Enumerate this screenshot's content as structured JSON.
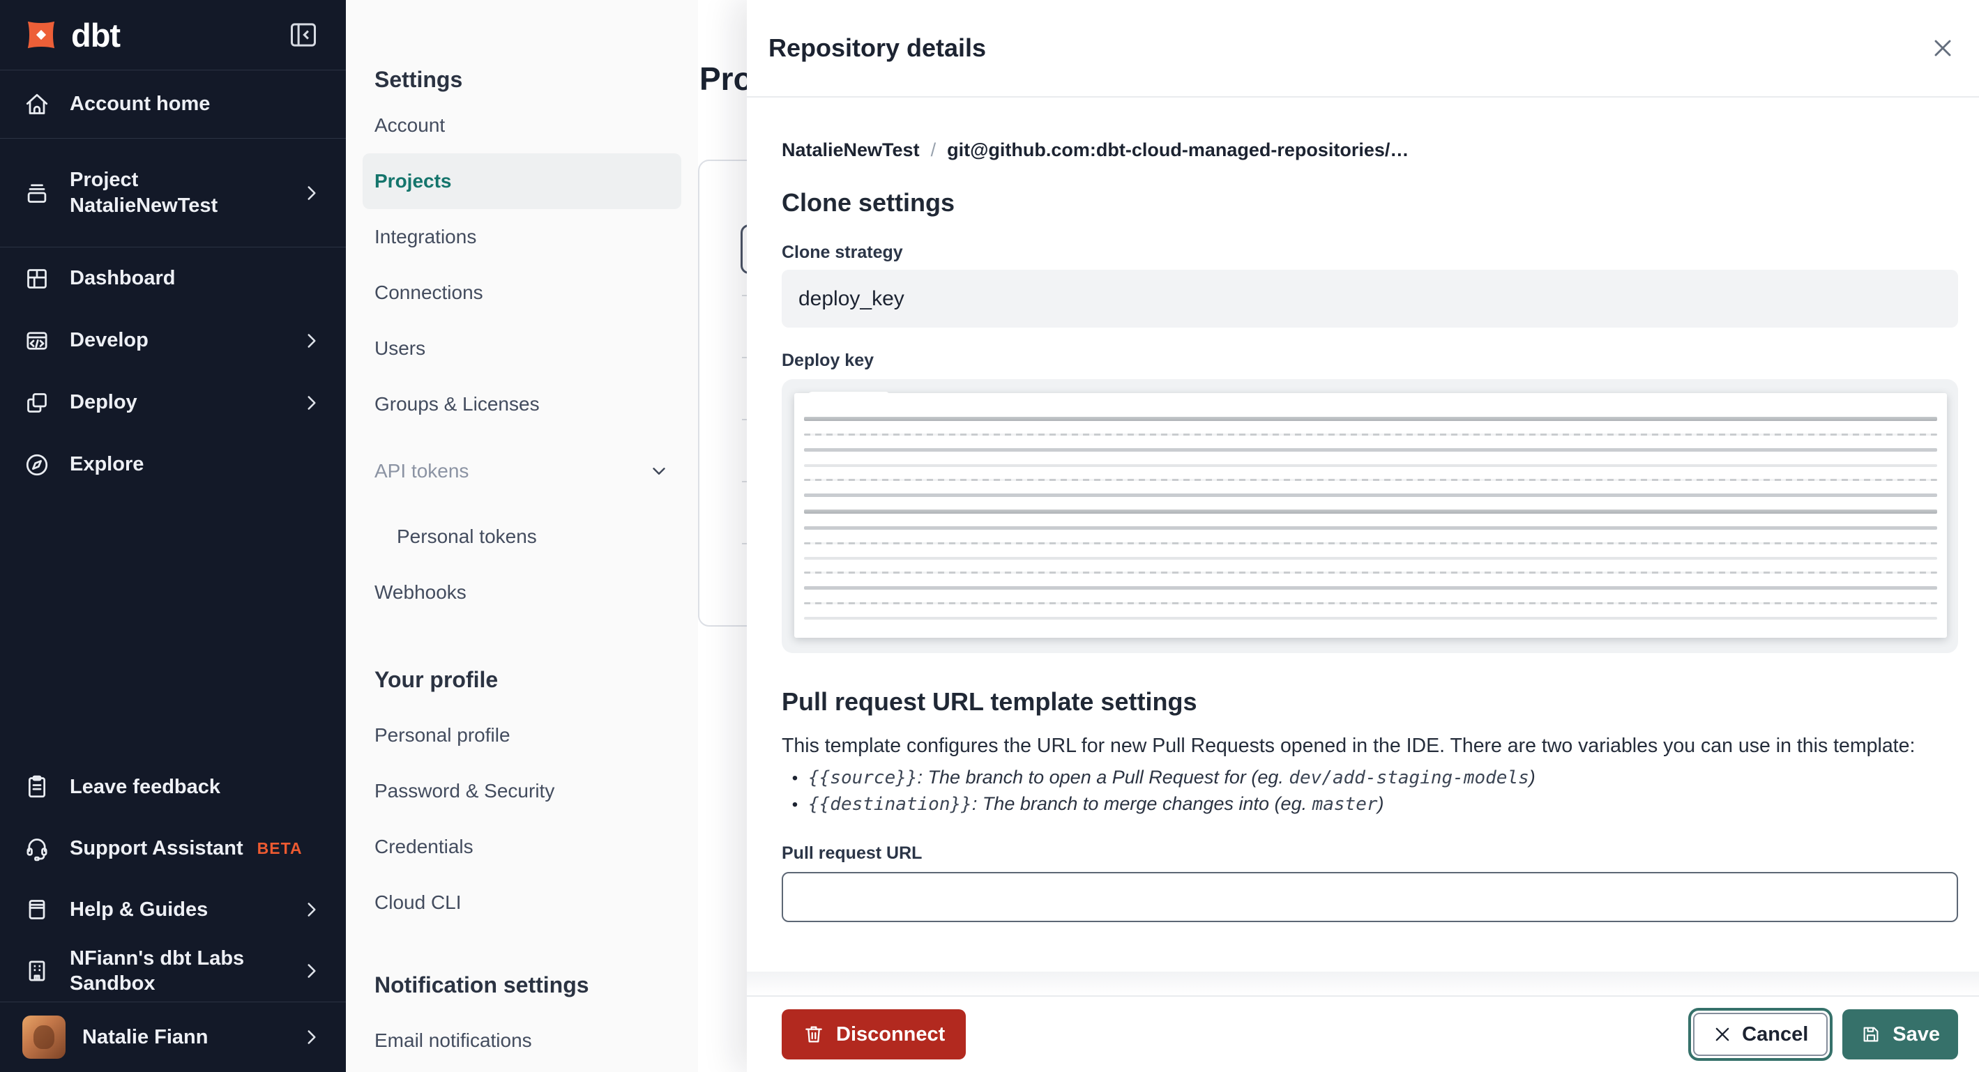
{
  "brand": {
    "logo_text": "dbt"
  },
  "sidebar": {
    "account_home": "Account home",
    "project_line1": "Project",
    "project_line2": "NatalieNewTest",
    "dashboard": "Dashboard",
    "develop": "Develop",
    "deploy": "Deploy",
    "explore": "Explore",
    "leave_feedback": "Leave feedback",
    "support_assistant": "Support Assistant",
    "beta_badge": "BETA",
    "help_guides": "Help & Guides",
    "sandbox": "NFiann's dbt Labs Sandbox",
    "user_name": "Natalie Fiann"
  },
  "settings_nav": {
    "heading": "Settings",
    "account": "Account",
    "projects": "Projects",
    "integrations": "Integrations",
    "connections": "Connections",
    "users": "Users",
    "groups_licenses": "Groups & Licenses",
    "api_tokens": "API tokens",
    "personal_tokens": "Personal tokens",
    "webhooks": "Webhooks",
    "profile_heading": "Your profile",
    "personal_profile": "Personal profile",
    "password_security": "Password & Security",
    "credentials": "Credentials",
    "cloud_cli": "Cloud CLI",
    "notification_heading": "Notification settings",
    "email_notifications": "Email notifications"
  },
  "main": {
    "title": "Projects"
  },
  "panel": {
    "title": "Repository details",
    "breadcrumb_project": "NatalieNewTest",
    "breadcrumb_sep": "/",
    "breadcrumb_repo": "git@github.com:dbt-cloud-managed-repositories/…",
    "clone_heading": "Clone settings",
    "clone_strategy_label": "Clone strategy",
    "clone_strategy_value": "deploy_key",
    "deploy_key_label": "Deploy key",
    "pr_heading": "Pull request URL template settings",
    "pr_intro": "This template configures the URL for new Pull Requests opened in the IDE. There are two variables you can use in this template:",
    "bullets": [
      {
        "code": "{{source}}",
        "desc": ": The branch to open a Pull Request for (eg. ",
        "example": "dev/add-staging-models",
        "close": ")"
      },
      {
        "code": "{{destination}}",
        "desc": ": The branch to merge changes into (eg. ",
        "example": "master",
        "close": ")"
      }
    ],
    "pr_url_label": "Pull request URL",
    "pr_url_value": "",
    "disconnect_label": "Disconnect",
    "cancel_label": "Cancel",
    "save_label": "Save"
  },
  "icons": {
    "dbt-logo": "orange four-point star",
    "collapse-sidebar": "panel with left chevron",
    "home": "house outline",
    "project": "stacked box",
    "dashboard": "grid",
    "develop": "code window",
    "deploy": "overlapping squares",
    "explore": "compass",
    "leave-feedback": "clipboard",
    "support": "headset",
    "help": "book",
    "sandbox": "building",
    "chevron-right": ">",
    "chevron-down": "v",
    "close": "x",
    "trash": "trash can",
    "cancel-x": "x",
    "save": "floppy disk"
  },
  "colors": {
    "sidebar_bg": "#131928",
    "brand_orange": "#ed5a31",
    "accent_teal": "#36716a",
    "selected_teal_text": "#15756c",
    "danger_red": "#b2291f"
  }
}
